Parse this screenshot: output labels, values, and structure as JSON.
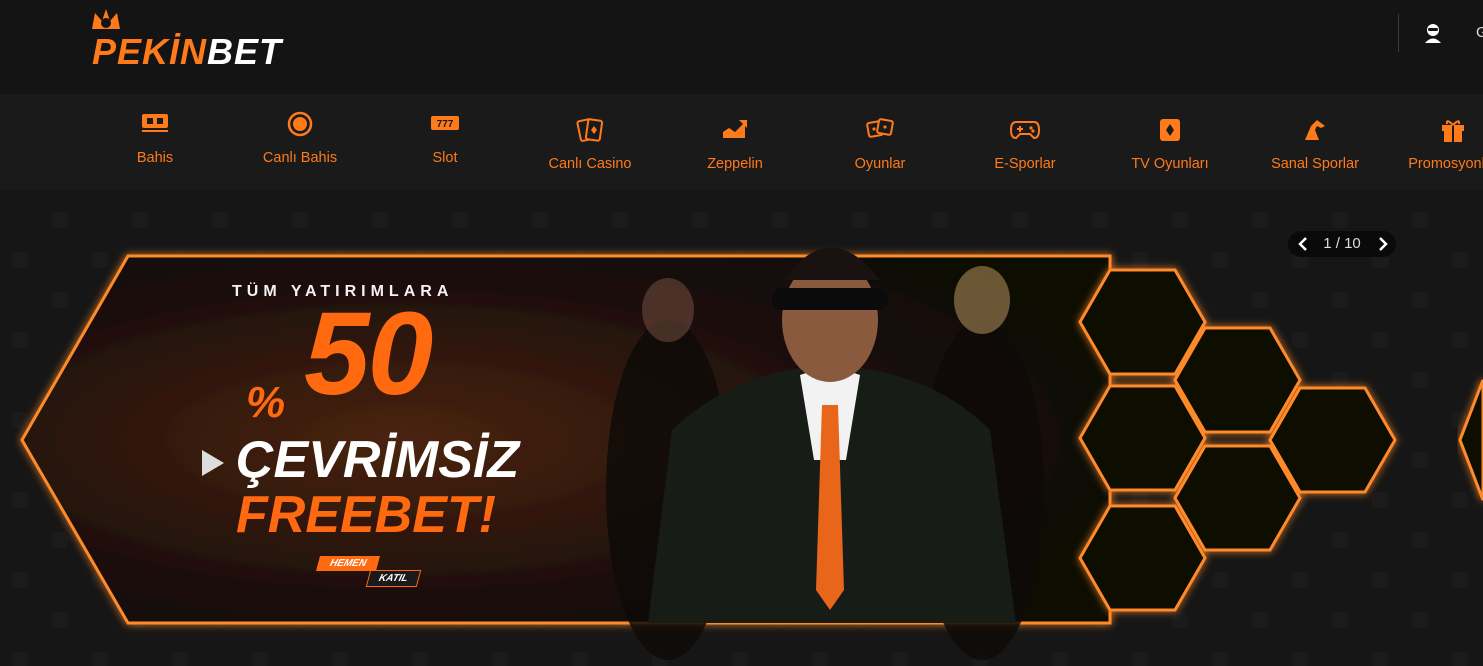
{
  "header": {
    "logo_part1": "PEKİN",
    "logo_part2": "BET",
    "extra_text": "G"
  },
  "nav": [
    {
      "label": "Bahis",
      "icon": "ticket-icon"
    },
    {
      "label": "Canlı Bahis",
      "icon": "live-dot-icon"
    },
    {
      "label": "Slot",
      "icon": "slot-777-icon"
    },
    {
      "label": "Canlı Casino",
      "icon": "cards-icon"
    },
    {
      "label": "Zeppelin",
      "icon": "chart-up-icon"
    },
    {
      "label": "Oyunlar",
      "icon": "dice-icon"
    },
    {
      "label": "E-Sporlar",
      "icon": "gamepad-icon"
    },
    {
      "label": "TV Oyunları",
      "icon": "tv-cards-icon"
    },
    {
      "label": "Sanal Sporlar",
      "icon": "horse-icon"
    },
    {
      "label": "Promosyonlar",
      "icon": "gift-icon"
    }
  ],
  "slider": {
    "counter": "1 / 10"
  },
  "banner": {
    "line1": "TÜM YATIRIMLARA",
    "percent": "%",
    "amount": "50",
    "line3": "ÇEVRİMSİZ",
    "line4": "FREEBET!",
    "cta_top": "HEMEN",
    "cta_bottom": "KATIL"
  },
  "colors": {
    "accent": "#ff7a1a",
    "background": "#161616"
  }
}
